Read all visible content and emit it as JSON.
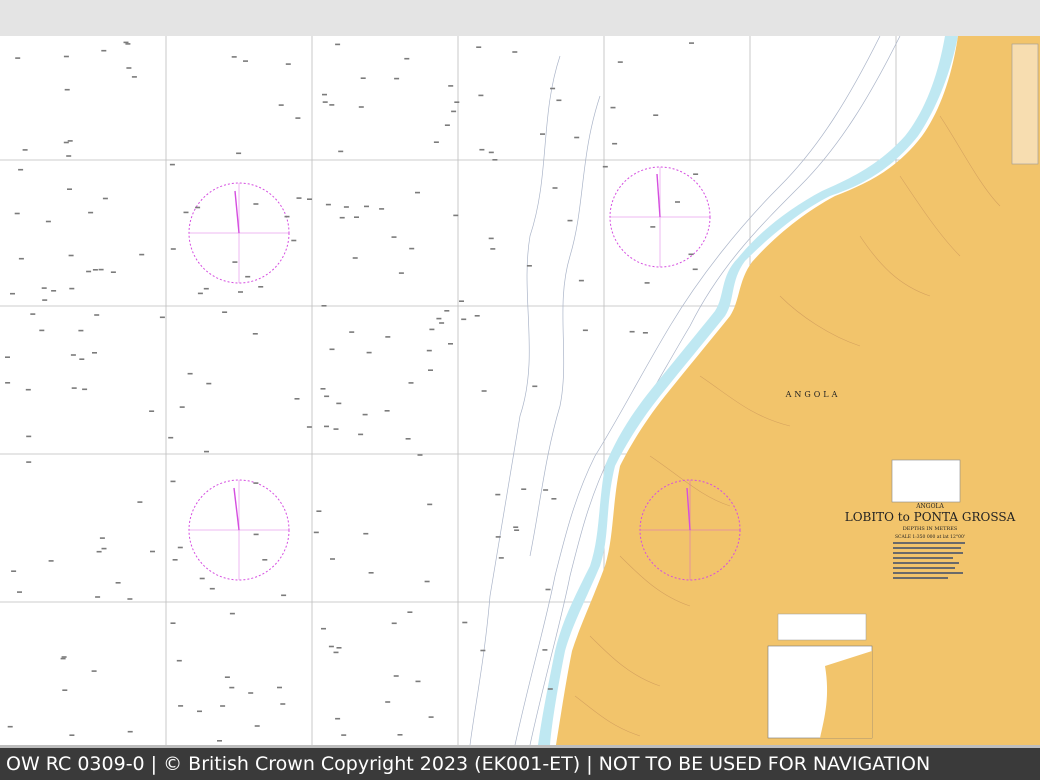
{
  "viewer": {
    "footer_text": "OW RC 0309-0 | © British Crown Copyright 2023 (EK001-ET) | NOT TO BE USED FOR NAVIGATION"
  },
  "chart": {
    "country_label": "ANGOLA",
    "title_small": "ANGOLA",
    "title": "LOBITO to PONTA GROSSA",
    "subtitle": "DEPTHS IN METRES",
    "scale": "SCALE 1:350 000 at lat 12°00'",
    "colors": {
      "land": "#f2c46b",
      "shallow_water": "#bfe8f2",
      "compass": "#d54ee0",
      "grid": "#9a9a9a",
      "sea": "#ffffff"
    }
  }
}
